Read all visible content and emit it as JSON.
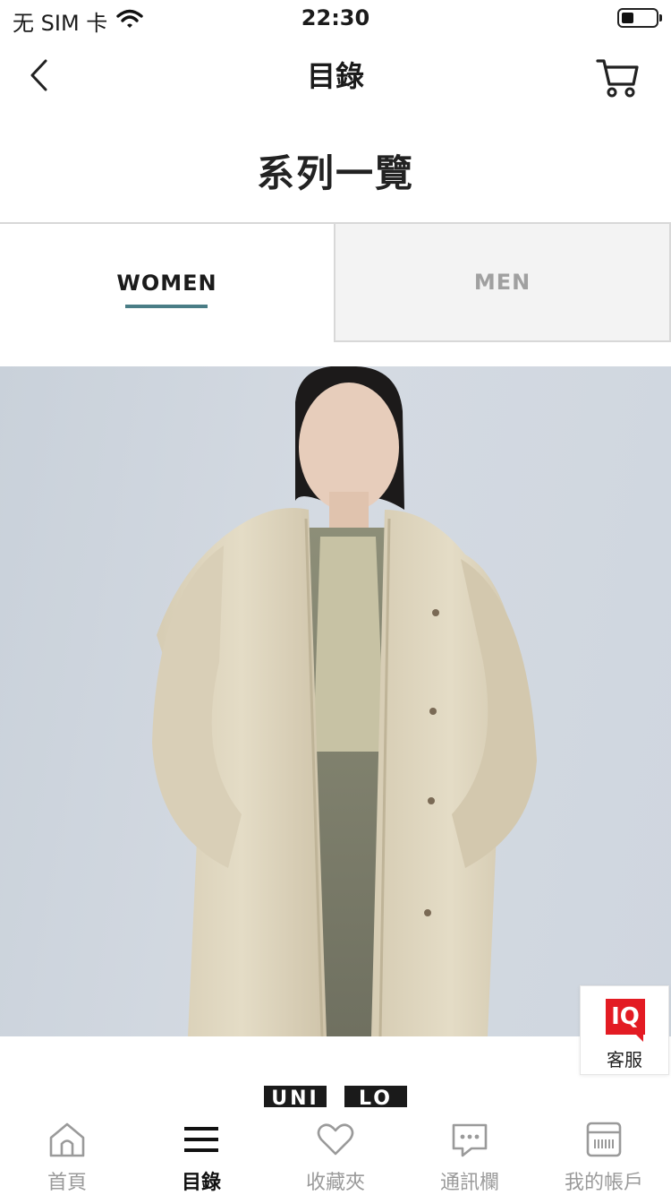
{
  "status_bar": {
    "carrier": "无 SIM 卡",
    "time": "22:30",
    "battery_level": 0.35
  },
  "nav": {
    "title": "目錄",
    "back_icon": "chevron-left-icon",
    "cart_icon": "cart-icon"
  },
  "page": {
    "heading": "系列一覽"
  },
  "gender_tabs": [
    {
      "label": "WOMEN",
      "selected": true
    },
    {
      "label": "MEN",
      "selected": false
    }
  ],
  "hero": {
    "description_icon": "model-photo"
  },
  "logo": {
    "parts": [
      "UNI",
      "LO"
    ]
  },
  "service": {
    "badge": "IQ",
    "label": "客服",
    "accent_color": "#e31b23"
  },
  "tab_bar": {
    "items": [
      {
        "label": "首頁",
        "icon": "home-icon",
        "active": false
      },
      {
        "label": "目錄",
        "icon": "menu-icon",
        "active": true
      },
      {
        "label": "收藏夾",
        "icon": "heart-icon",
        "active": false
      },
      {
        "label": "通訊欄",
        "icon": "message-icon",
        "active": false
      },
      {
        "label": "我的帳戶",
        "icon": "member-card-icon",
        "active": false
      }
    ]
  },
  "colors": {
    "tab_underline": "#4a7d86",
    "inactive_text": "#9a9a9a"
  }
}
